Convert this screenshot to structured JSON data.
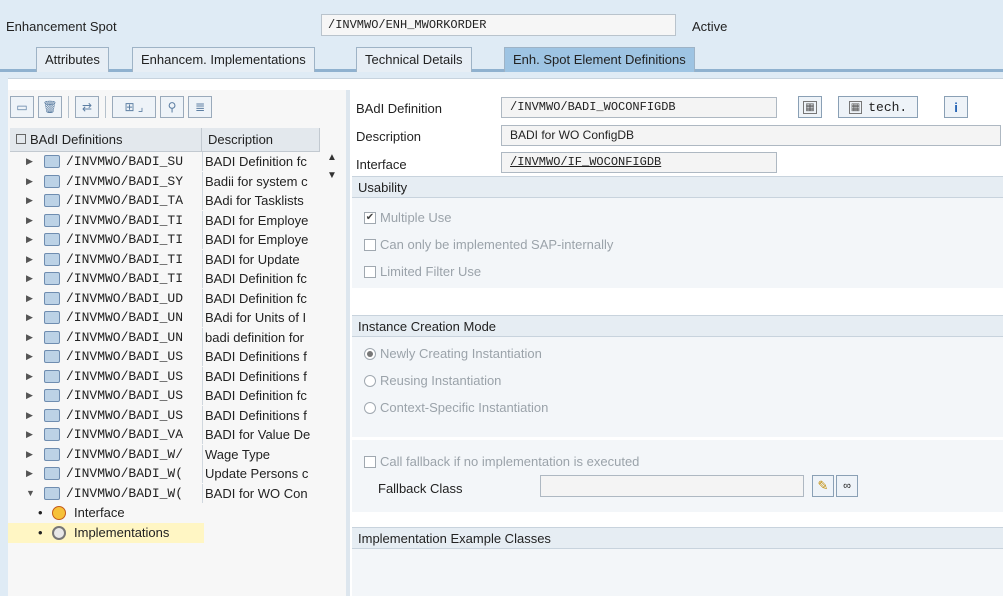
{
  "header": {
    "enhancement_spot_label": "Enhancement Spot",
    "enhancement_spot_value": "/INVMWO/ENH_MWORKORDER",
    "status": "Active"
  },
  "tabs": [
    {
      "label": "Attributes"
    },
    {
      "label": "Enhancem. Implementations"
    },
    {
      "label": "Technical Details"
    },
    {
      "label": "Enh. Spot Element Definitions"
    }
  ],
  "left": {
    "col_badi": "BAdI Definitions",
    "col_desc": "Description",
    "rows": [
      {
        "name": "/INVMWO/BADI_SU",
        "desc": "BADI Definition fc"
      },
      {
        "name": "/INVMWO/BADI_SY",
        "desc": "Badii for system c"
      },
      {
        "name": "/INVMWO/BADI_TA",
        "desc": "BAdi for Tasklists"
      },
      {
        "name": "/INVMWO/BADI_TI",
        "desc": "BADI for Employe"
      },
      {
        "name": "/INVMWO/BADI_TI",
        "desc": "BADI for Employe"
      },
      {
        "name": "/INVMWO/BADI_TI",
        "desc": "BADI for Update"
      },
      {
        "name": "/INVMWO/BADI_TI",
        "desc": "BADI Definition fc"
      },
      {
        "name": "/INVMWO/BADI_UD",
        "desc": "BADI Definition fc"
      },
      {
        "name": "/INVMWO/BADI_UN",
        "desc": "BAdi for Units of I"
      },
      {
        "name": "/INVMWO/BADI_UN",
        "desc": "badi definition for"
      },
      {
        "name": "/INVMWO/BADI_US",
        "desc": "BADI Definitions f"
      },
      {
        "name": "/INVMWO/BADI_US",
        "desc": "BADI Definitions f"
      },
      {
        "name": "/INVMWO/BADI_US",
        "desc": "BADI Definition fc"
      },
      {
        "name": "/INVMWO/BADI_US",
        "desc": "BADI Definitions f"
      },
      {
        "name": "/INVMWO/BADI_VA",
        "desc": "BADI for Value De"
      },
      {
        "name": "/INVMWO/BADI_W/",
        "desc": "Wage Type"
      },
      {
        "name": "/INVMWO/BADI_W(",
        "desc": "Update Persons c"
      },
      {
        "name": "/INVMWO/BADI_W(",
        "desc": "BADI for WO Con"
      }
    ],
    "sub_interface": "Interface",
    "sub_implementations": "Implementations"
  },
  "right": {
    "badi_def_label": "BAdI Definition",
    "badi_def_value": "/INVMWO/BADI_WOCONFIGDB",
    "tech_label": "tech.",
    "description_label": "Description",
    "description_value": "BADI for WO ConfigDB",
    "interface_label": "Interface",
    "interface_value": "/INVMWO/IF_WOCONFIGDB",
    "usability_header": "Usability",
    "multiple_use": "Multiple Use",
    "sap_internal": "Can only be implemented SAP-internally",
    "limited_filter": "Limited Filter Use",
    "instance_header": "Instance Creation Mode",
    "newly_creating": "Newly Creating Instantiation",
    "reusing": "Reusing Instantiation",
    "context_specific": "Context-Specific Instantiation",
    "call_fallback": "Call fallback if no implementation is executed",
    "fallback_class_label": "Fallback Class",
    "fallback_class_value": "",
    "impl_example_header": "Implementation Example Classes"
  },
  "colors": {
    "background": "#dfebf5",
    "active_tab": "#9ec4e3",
    "highlight": "#fff6c4"
  }
}
